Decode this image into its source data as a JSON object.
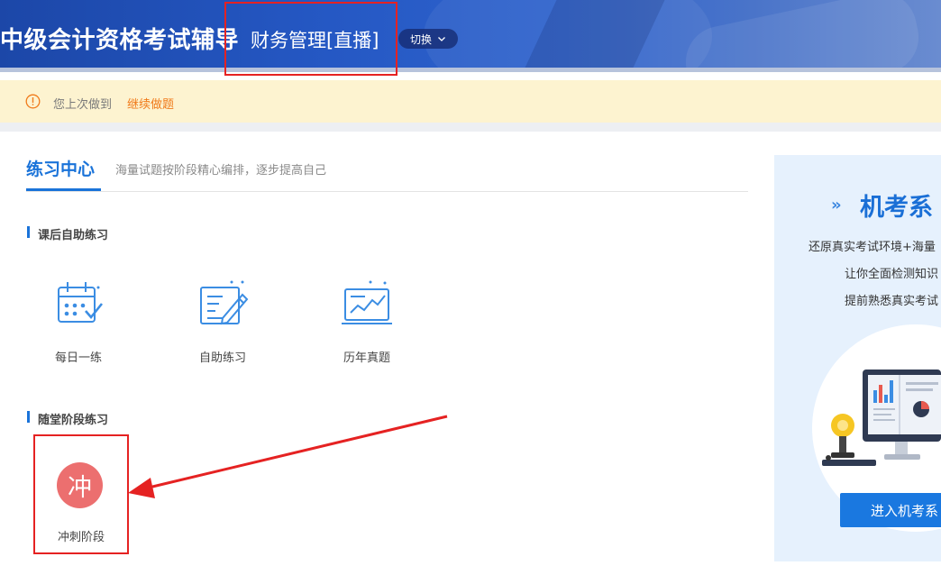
{
  "header": {
    "site_title": "中级会计资格考试辅导",
    "course_name": "财务管理[直播]",
    "switch_label": "切换"
  },
  "notice": {
    "icon": "info-icon",
    "text": "您上次做到",
    "link": "继续做题"
  },
  "practice": {
    "title": "练习中心",
    "subtitle": "海量试题按阶段精心编排，逐步提高自己",
    "section1": {
      "title": "课后自助练习",
      "tools": [
        {
          "label": "每日一练",
          "icon": "calendar-check-icon"
        },
        {
          "label": "自助练习",
          "icon": "form-pencil-icon"
        },
        {
          "label": "历年真题",
          "icon": "trend-monitor-icon"
        }
      ]
    },
    "section2": {
      "title": "随堂阶段练习",
      "stage": {
        "char": "冲",
        "label": "冲刺阶段"
      }
    }
  },
  "promo": {
    "chevron": "»",
    "title": "机考系",
    "lines": [
      "还原真实考试环境+海量",
      "让你全面检测知识",
      "提前熟悉真实考试"
    ],
    "button": "进入机考系"
  },
  "colors": {
    "primary": "#1a73d9",
    "banner": "#2558c4",
    "notice_bg": "#fdf3d0",
    "notice_link": "#f07a1a",
    "stage_circle": "#ec6f6f",
    "annotation_red": "#e52222"
  }
}
